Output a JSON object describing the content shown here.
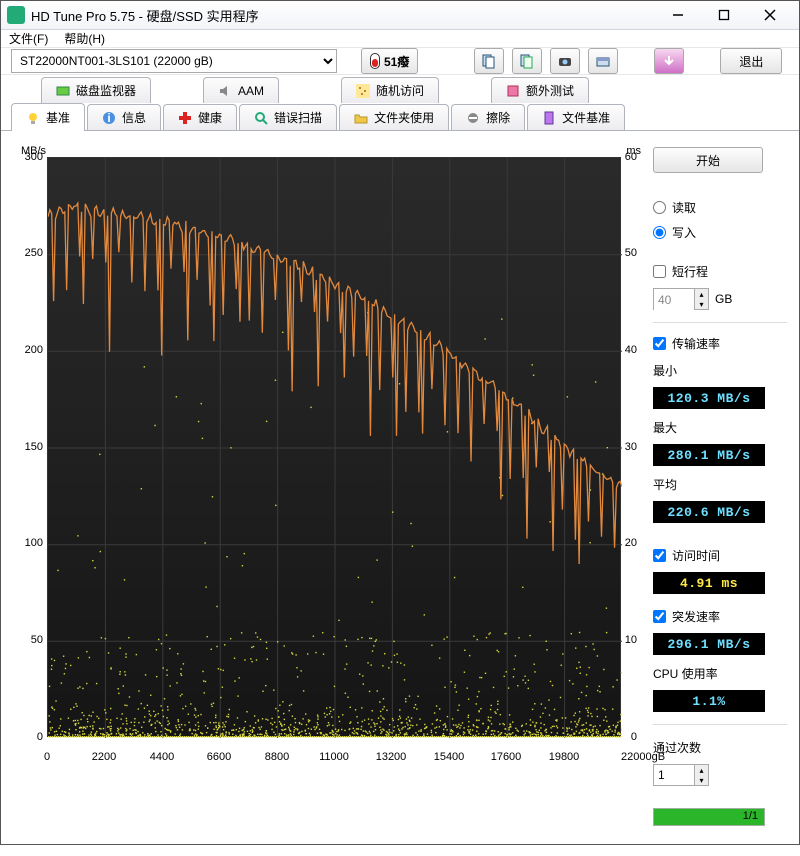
{
  "window": {
    "title": "HD Tune Pro 5.75 - 硬盘/SSD 实用程序"
  },
  "menu": {
    "file": "文件(F)",
    "help": "帮助(H)"
  },
  "toolbar": {
    "drive_selected": "ST22000NT001-3LS101 (22000 gB)",
    "temp": "51癈",
    "exit": "退出"
  },
  "tabs_row1": {
    "monitor": "磁盘监视器",
    "aam": "AAM",
    "random": "随机访问",
    "extra": "额外测试"
  },
  "tabs_row2": {
    "benchmark": "基准",
    "info": "信息",
    "health": "健康",
    "errscan": "错误扫描",
    "folder": "文件夹使用",
    "erase": "擦除",
    "filebench": "文件基准"
  },
  "sidebar": {
    "start": "开始",
    "read": "读取",
    "write": "写入",
    "shortstroke": "短行程",
    "shortstroke_val": "40",
    "shortstroke_unit": "GB",
    "transfer": "传输速率",
    "min_label": "最小",
    "min_val": "120.3 MB/s",
    "max_label": "最大",
    "max_val": "280.1 MB/s",
    "avg_label": "平均",
    "avg_val": "220.6 MB/s",
    "access": "访问时间",
    "access_val": "4.91 ms",
    "burst": "突发速率",
    "burst_val": "296.1 MB/s",
    "cpu_label": "CPU 使用率",
    "cpu_val": "1.1%",
    "passes_label": "通过次数",
    "passes_val": "1",
    "progress_txt": "1/1"
  },
  "chart": {
    "y_left_label": "MB/s",
    "y_right_label": "ms",
    "x_unit": "22000gB",
    "y_left_ticks": [
      "300",
      "250",
      "200",
      "150",
      "100",
      "50",
      "0"
    ],
    "y_right_ticks": [
      "60",
      "50",
      "40",
      "30",
      "20",
      "10",
      "0"
    ],
    "x_ticks": [
      "0",
      "2200",
      "4400",
      "6600",
      "8800",
      "11000",
      "13200",
      "15400",
      "17600",
      "19800",
      "22000gB"
    ]
  },
  "chart_data": {
    "type": "line+scatter",
    "title": "",
    "x_range": [
      0,
      22000
    ],
    "y_left_range": [
      0,
      300
    ],
    "y_right_range": [
      0,
      60
    ],
    "x_unit": "gB",
    "series": [
      {
        "name": "transfer_rate",
        "axis": "left",
        "unit": "MB/s",
        "color": "#e2893e",
        "x": [
          0,
          1000,
          2000,
          3000,
          4000,
          5000,
          6000,
          7000,
          8000,
          9000,
          10000,
          11000,
          12000,
          13000,
          14000,
          15000,
          16000,
          17000,
          18000,
          19000,
          20000,
          21000,
          22000
        ],
        "y": [
          270,
          275,
          272,
          270,
          268,
          265,
          262,
          258,
          253,
          248,
          242,
          235,
          228,
          220,
          212,
          203,
          193,
          183,
          172,
          160,
          148,
          138,
          130
        ]
      },
      {
        "name": "access_time",
        "axis": "right",
        "unit": "ms",
        "color": "#d6d640",
        "type": "scatter",
        "approx_distribution": "mostly 0.5-6 ms, occasional spikes up to 30-45 ms, denser band near 1-2 ms across full x range"
      }
    ]
  }
}
